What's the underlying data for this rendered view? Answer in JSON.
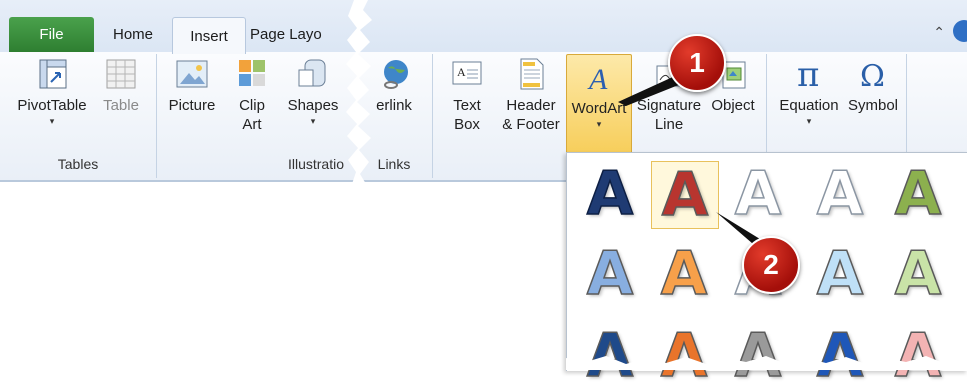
{
  "tabs": {
    "file": "File",
    "home": "Home",
    "insert": "Insert",
    "page_layout": "Page Layo"
  },
  "ribbon": {
    "pivottable": "PivotTable",
    "table": "Table",
    "picture": "Picture",
    "clipart": "Clip\nArt",
    "shapes": "Shapes",
    "hyperlink": "erlink",
    "textbox": "Text\nBox",
    "header_footer": "Header\n& Footer",
    "wordart": "WordArt",
    "signature_line": "Signature\nLine",
    "object": "Object",
    "equation": "Equation",
    "symbol": "Symbol",
    "group_tables": "Tables",
    "group_illustrations": "Illustratio",
    "group_links": "Links"
  },
  "arrows": {
    "down": "▾"
  },
  "callouts": {
    "one": "1",
    "two": "2"
  },
  "gallery": {
    "glyph": "A",
    "rows": [
      [
        "#1f3b73",
        "#b8352f",
        "#e6e6e6",
        "#dfe8f2",
        "#8cb04e"
      ],
      [
        "#88aee0",
        "#f7a04a",
        "#dedede",
        "#bfe0f7",
        "#c9e3a7"
      ],
      [
        "#1f4a8a",
        "#e9742b",
        "#9a9a9a",
        "#1f57b8",
        "#f3b3b3"
      ]
    ]
  }
}
